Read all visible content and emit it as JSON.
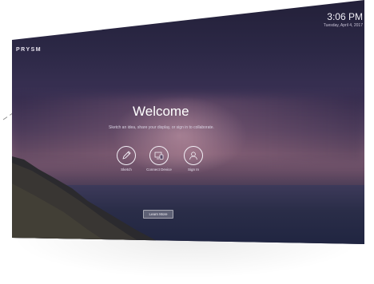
{
  "brand": {
    "name": "PRYSM"
  },
  "clock": {
    "time": "3:06 PM",
    "date": "Tuesday, April 4, 2017"
  },
  "hero": {
    "title": "Welcome",
    "subtitle": "Sketch an idea, share your display, or sign in to collaborate."
  },
  "actions": [
    {
      "label": "Sketch",
      "icon": "pen-icon"
    },
    {
      "label": "Connect Device",
      "icon": "device-icon"
    },
    {
      "label": "Sign In",
      "icon": "user-icon"
    }
  ],
  "learn_more": {
    "label": "Learn More"
  }
}
